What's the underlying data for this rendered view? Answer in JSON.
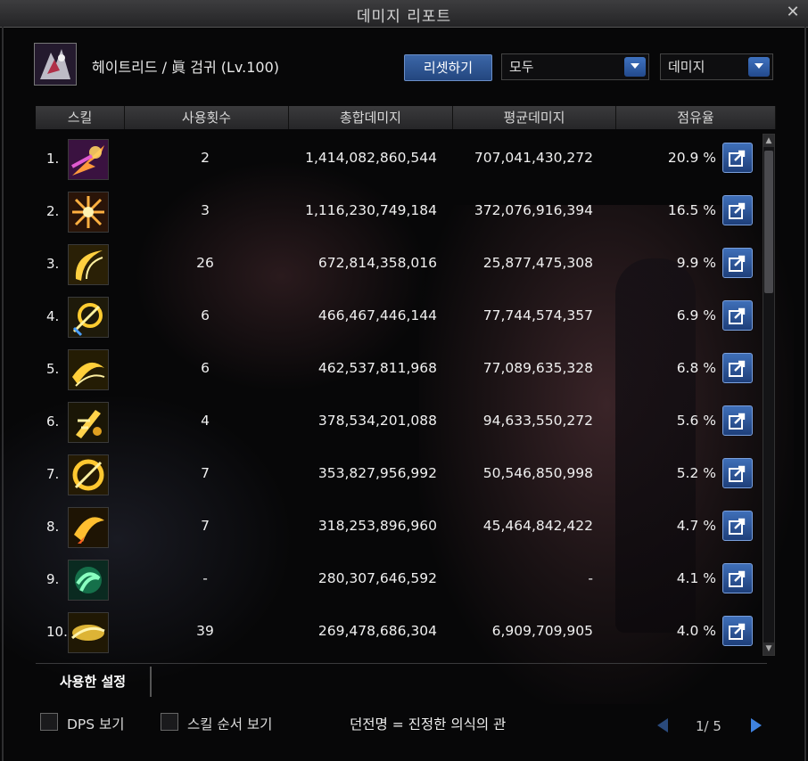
{
  "window": {
    "title": "데미지 리포트"
  },
  "character": {
    "name": "헤이트리드 / 眞 검귀 (Lv.100)"
  },
  "controls": {
    "reset_label": "리셋하기",
    "filter_value": "모두",
    "type_value": "데미지"
  },
  "table": {
    "headers": [
      "스킬",
      "사용횟수",
      "총합데미지",
      "평균데미지",
      "점유율"
    ],
    "rows": [
      {
        "rank": "1.",
        "uses": "2",
        "total": "1,414,082,860,544",
        "avg": "707,041,430,272",
        "share": "20.9 %",
        "icon": "slash-burst-pink-icon"
      },
      {
        "rank": "2.",
        "uses": "3",
        "total": "1,116,230,749,184",
        "avg": "372,076,916,394",
        "share": "16.5 %",
        "icon": "star-burst-orange-icon"
      },
      {
        "rank": "3.",
        "uses": "26",
        "total": "672,814,358,016",
        "avg": "25,877,475,308",
        "share": "9.9 %",
        "icon": "crescent-slash-gold-icon"
      },
      {
        "rank": "4.",
        "uses": "6",
        "total": "466,467,446,144",
        "avg": "77,744,574,357",
        "share": "6.9 %",
        "icon": "whirl-slash-gold-icon"
      },
      {
        "rank": "5.",
        "uses": "6",
        "total": "462,537,811,968",
        "avg": "77,089,635,328",
        "share": "6.8 %",
        "icon": "wave-slash-gold-icon"
      },
      {
        "rank": "6.",
        "uses": "4",
        "total": "378,534,201,088",
        "avg": "94,633,550,272",
        "share": "5.6 %",
        "icon": "character-slash-gold-icon"
      },
      {
        "rank": "7.",
        "uses": "7",
        "total": "353,827,956,992",
        "avg": "50,546,850,998",
        "share": "5.2 %",
        "icon": "circle-slash-gold-icon"
      },
      {
        "rank": "8.",
        "uses": "7",
        "total": "318,253,896,960",
        "avg": "45,464,842,422",
        "share": "4.7 %",
        "icon": "flame-slash-gold-icon"
      },
      {
        "rank": "9.",
        "uses": "-",
        "total": "280,307,646,592",
        "avg": "-",
        "share": "4.1 %",
        "icon": "swirl-green-icon"
      },
      {
        "rank": "10.",
        "uses": "39",
        "total": "269,478,686,304",
        "avg": "6,909,709,905",
        "share": "4.0 %",
        "icon": "beam-slash-gold-icon"
      }
    ]
  },
  "tabs": {
    "used_settings": "사용한 설정"
  },
  "options": {
    "dps_label": "DPS 보기",
    "skill_order_label": "스킬 순서 보기"
  },
  "dungeon": {
    "label": "던전명 = 진정한 의식의 관"
  },
  "pager": {
    "text": "1/ 5"
  },
  "colors": {
    "accent_blue": "#2f5aa0",
    "text": "#f0f0f0"
  }
}
